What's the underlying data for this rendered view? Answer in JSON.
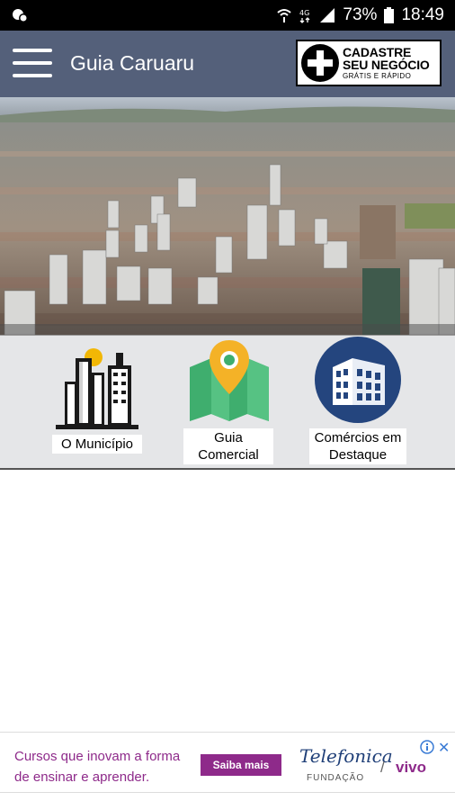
{
  "status_bar": {
    "battery": "73%",
    "time": "18:49",
    "icons": [
      "notification-icon",
      "wifi-icon",
      "4g-icon",
      "signal-icon",
      "battery-icon"
    ]
  },
  "app_bar": {
    "title": "Guia Caruaru",
    "register": {
      "line1": "CADASTRE",
      "line2": "SEU NEGÓCIO",
      "line3": "GRÁTIS E RÁPIDO"
    },
    "color": "#54607a"
  },
  "hero": {
    "subject": "aerial-city-photo"
  },
  "shortcuts": [
    {
      "label": "O Município",
      "icon": "city-buildings-icon"
    },
    {
      "label": "Guia Comercial",
      "icon": "map-pin-icon"
    },
    {
      "label": "Comércios em Destaque",
      "icon": "building-icon"
    }
  ],
  "ad": {
    "text": "Cursos que inovam a forma de ensinar e aprender.",
    "cta": "Saiba mais",
    "brand": "Telefonica",
    "brand_sub": "FUNDAÇÃO",
    "brand_partner": "vivo",
    "accent": "#8e2a8a"
  }
}
